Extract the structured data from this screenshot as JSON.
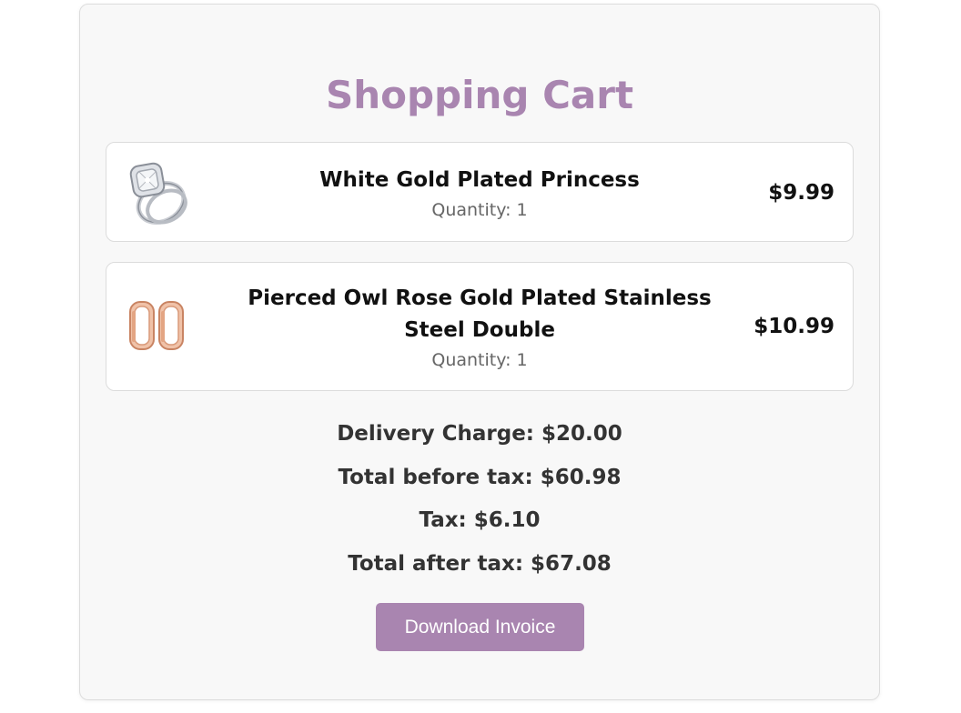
{
  "cart": {
    "title": "Shopping Cart",
    "items": [
      {
        "name": "White Gold Plated Princess",
        "quantity_text": "Quantity: 1",
        "price": "$9.99",
        "image_icon": "diamond-ring-icon"
      },
      {
        "name": "Pierced Owl Rose Gold Plated Stainless Steel Double",
        "quantity_text": "Quantity: 1",
        "price": "$10.99",
        "image_icon": "rose-gold-plugs-icon"
      }
    ],
    "summary": {
      "delivery": "Delivery Charge: $20.00",
      "total_before_tax": "Total before tax: $60.98",
      "tax": "Tax: $6.10",
      "total_after_tax": "Total after tax: $67.08"
    },
    "download_label": "Download Invoice"
  },
  "colors": {
    "accent": "#a985b0",
    "panel_bg": "#f8f8f8",
    "item_bg": "#ffffff"
  }
}
